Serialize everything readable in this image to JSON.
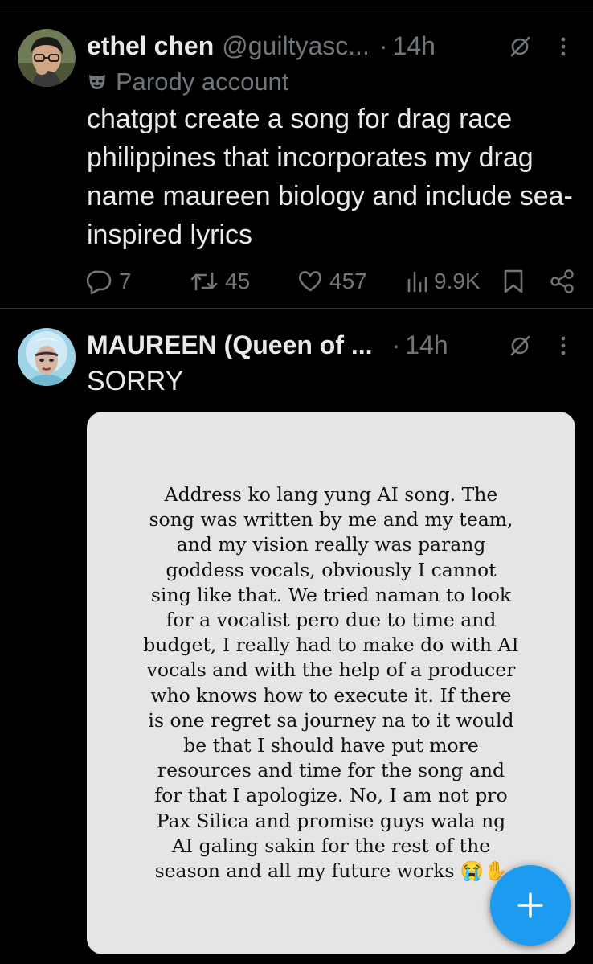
{
  "tweets": [
    {
      "name": "ethel chen",
      "handle": "@guiltyasc...",
      "dot": "·",
      "time": "14h",
      "badge": "Parody account",
      "text": "chatgpt create a song for drag race philippines that incorporates my drag name maureen biology and include sea-inspired lyrics",
      "stats": {
        "replies": "7",
        "reposts": "45",
        "likes": "457",
        "views": "9.9K"
      }
    },
    {
      "name": "MAUREEN (Queen of ...",
      "dot": "·",
      "time": "14h",
      "text": "SORRY",
      "image_text": "Address ko lang yung AI song. The song was written by me and my team, and my vision really was parang goddess vocals, obviously I cannot sing like that. We tried naman to look for a vocalist pero due to time and budget, I really had to make do with AI vocals and with the help of a producer who knows how to execute it. If there is one regret sa journey na to it would be that I should have put more resources and time for the song and for that I apologize. No, I am not pro Pax Silica and promise guys wala ng AI galing sakin for the rest of the season and all my future works 😭✋"
    }
  ],
  "icons": {
    "reply": "comment-bubble-icon",
    "repost": "repost-arrows-icon",
    "like": "heart-icon",
    "views": "bar-chart-icon",
    "bookmark": "bookmark-icon",
    "share": "share-icon",
    "grok": "grok-slash-icon",
    "more": "vertical-dots-icon",
    "compose": "plus-icon",
    "parody": "mask-icon"
  },
  "colors": {
    "background": "#000000",
    "text": "#e7e9ea",
    "muted": "#71767b",
    "accent": "#1d9bf0",
    "card": "#e6e5e5"
  }
}
